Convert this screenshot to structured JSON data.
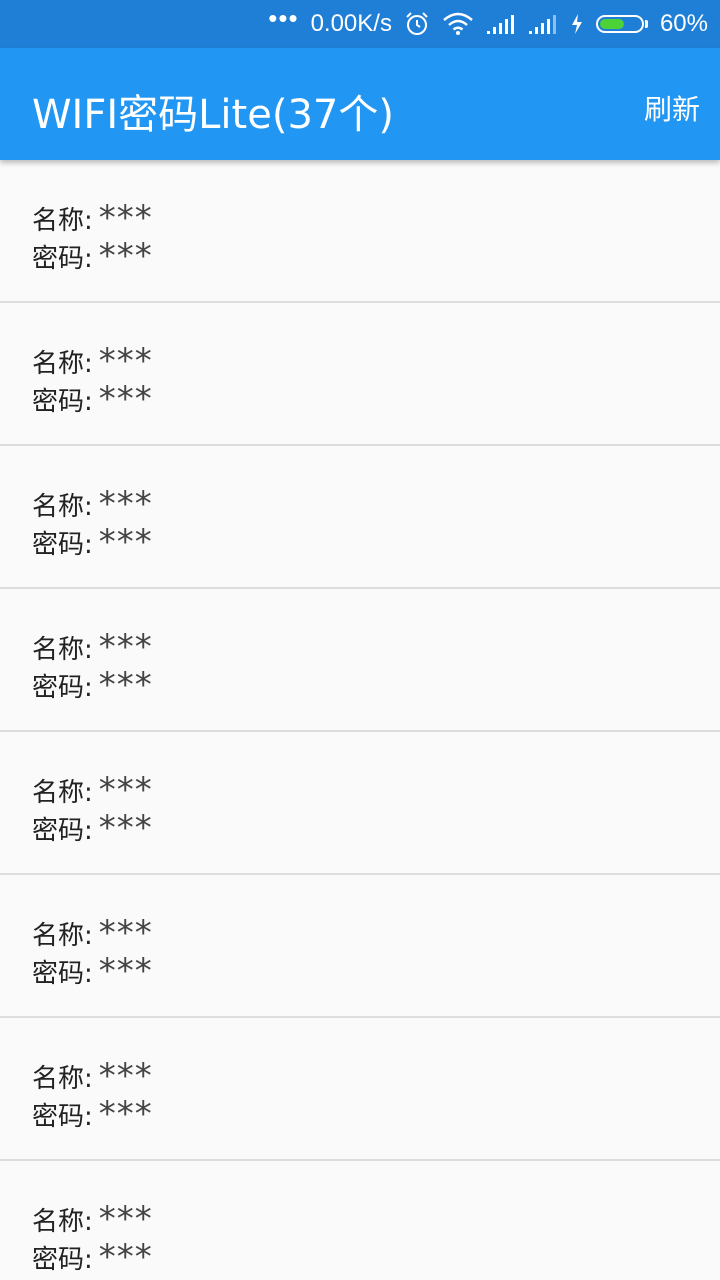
{
  "status_bar": {
    "dots": "•••",
    "speed": "0.00K/s",
    "battery_percent": "60%",
    "battery_level": 0.6,
    "icons": [
      "alarm-icon",
      "wifi-icon",
      "signal-icon",
      "signal-icon",
      "charging-icon",
      "battery-icon"
    ],
    "battery_color": "#4cd137"
  },
  "app_bar": {
    "title": "WIFI密码Lite(37个)",
    "refresh_label": "刷新",
    "color": "#2196f3"
  },
  "labels": {
    "name": "名称:",
    "password": "密码:"
  },
  "items": [
    {
      "name": "***",
      "password": "***"
    },
    {
      "name": "***",
      "password": "***"
    },
    {
      "name": "***",
      "password": "***"
    },
    {
      "name": "***",
      "password": "***"
    },
    {
      "name": "***",
      "password": "***"
    },
    {
      "name": "***",
      "password": "***"
    },
    {
      "name": "***",
      "password": "***"
    },
    {
      "name": "***",
      "password": "***"
    }
  ]
}
